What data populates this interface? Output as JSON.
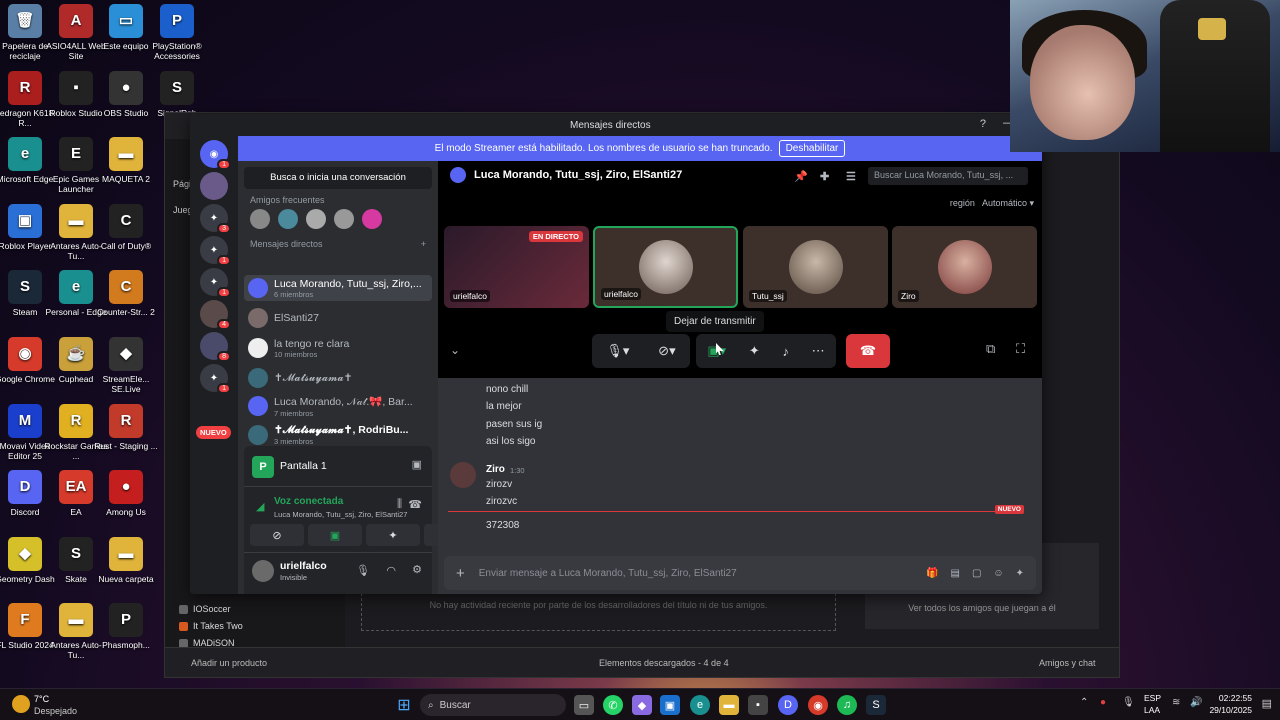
{
  "desktop_icons": [
    {
      "label": "Papelera de reciclaje",
      "glyph": "🗑",
      "color": "#5a7fa6"
    },
    {
      "label": "ASIO4ALL Web Site",
      "glyph": "A",
      "color": "#b02a2a"
    },
    {
      "label": "Este equipo",
      "glyph": "▭",
      "color": "#2a8fd6"
    },
    {
      "label": "PlayStation® Accessories",
      "glyph": "P",
      "color": "#1a5fcc"
    },
    {
      "label": "Redragon K618-R...",
      "glyph": "R",
      "color": "#aa1e1e"
    },
    {
      "label": "Roblox Studio",
      "glyph": "▪",
      "color": "#222"
    },
    {
      "label": "OBS Studio",
      "glyph": "●",
      "color": "#333"
    },
    {
      "label": "SignalRgb",
      "glyph": "S",
      "color": "#222"
    },
    {
      "label": "Microsoft Edge",
      "glyph": "e",
      "color": "#1a8f8f"
    },
    {
      "label": "Epic Games Launcher",
      "glyph": "E",
      "color": "#222"
    },
    {
      "label": "MAQUETA 2",
      "glyph": "▬",
      "color": "#e0b43a"
    },
    {
      "label": "Roblox Player",
      "glyph": "▣",
      "color": "#2a6fd6"
    },
    {
      "label": "Antares Auto-Tu...",
      "glyph": "▬",
      "color": "#e0b43a"
    },
    {
      "label": "Call of Duty®",
      "glyph": "C",
      "color": "#222"
    },
    {
      "label": "Steam",
      "glyph": "S",
      "color": "#1b2838"
    },
    {
      "label": "Personal - Edge",
      "glyph": "e",
      "color": "#1a8f8f"
    },
    {
      "label": "Counter-Str... 2",
      "glyph": "C",
      "color": "#d27a1e"
    },
    {
      "label": "Google Chrome",
      "glyph": "◉",
      "color": "#d63a2a"
    },
    {
      "label": "Cuphead",
      "glyph": "☕",
      "color": "#c9a03a"
    },
    {
      "label": "StreamEle... SE.Live",
      "glyph": "◆",
      "color": "#333"
    },
    {
      "label": "Movavi Video Editor 25",
      "glyph": "M",
      "color": "#1a3fcc"
    },
    {
      "label": "Rockstar Games ...",
      "glyph": "R",
      "color": "#e0b020"
    },
    {
      "label": "Rust - Staging ...",
      "glyph": "R",
      "color": "#c23a2a"
    },
    {
      "label": "Discord",
      "glyph": "D",
      "color": "#5865f2"
    },
    {
      "label": "EA",
      "glyph": "EA",
      "color": "#d63a2a"
    },
    {
      "label": "Among Us",
      "glyph": "●",
      "color": "#c41e1e"
    },
    {
      "label": "Geometry Dash",
      "glyph": "◆",
      "color": "#d6c02a"
    },
    {
      "label": "Skate",
      "glyph": "S",
      "color": "#222"
    },
    {
      "label": "Nueva carpeta",
      "glyph": "▬",
      "color": "#e0b43a"
    },
    {
      "label": "FL Studio 2024",
      "glyph": "F",
      "color": "#e07a1e"
    },
    {
      "label": "Antares Auto-Tu...",
      "glyph": "▬",
      "color": "#e0b43a"
    },
    {
      "label": "Phasmoph...",
      "glyph": "P",
      "color": "#222"
    }
  ],
  "launcher": {
    "sidebar_labels": [
      "Pági",
      "Jueg"
    ],
    "games": [
      "IOSoccer",
      "It Takes Two",
      "MADiSON"
    ],
    "empty_activity": "No hay actividad reciente por parte de los desarrolladores del título ni de tus amigos.",
    "friends_link": "Ver todos los amigos que juegan a él",
    "footer": {
      "add": "Añadir un producto",
      "downloads": "Elementos descargados - 4 de 4",
      "friends": "Amigos y chat"
    }
  },
  "discord": {
    "title": "Mensajes directos",
    "streamer_banner": "El modo Streamer está habilitado. Los nombres de usuario se han truncado.",
    "disable_button": "Deshabilitar",
    "guild_badges": [
      "1",
      "3",
      "1",
      "1",
      "4",
      "8",
      "1"
    ],
    "new_label": "NUEVO",
    "search_conversation": "Busca o inicia una conversación",
    "frequent_friends": "Amigos frecuentes",
    "direct_messages": "Mensajes directos",
    "dms": [
      {
        "name": "Luca Morando, Tutu_ssj, Ziro,...",
        "sub": "6 miembros",
        "selected": true
      },
      {
        "name": "ElSanti27",
        "sub": ""
      },
      {
        "name": "la tengo re clara",
        "sub": "10 miembros"
      },
      {
        "name": "✝𝓜𝓪𝓽𝓼𝓾𝔂𝓪𝓶𝓪✝",
        "sub": ""
      },
      {
        "name": "Luca Morando, 𝒩𝒶𝓉.🎀, Bar...",
        "sub": "7 miembros"
      },
      {
        "name": "✝𝓜𝓪𝓽𝓼𝓾𝔂𝓪𝓶𝓪✝, RodriBu...",
        "sub": "3 miembros"
      }
    ],
    "stream_panel": {
      "title": "Pantalla 1"
    },
    "voice": {
      "status": "Voz conectada",
      "channel": "Luca Morando, Tutu_ssj, Ziro, ElSanti27"
    },
    "user": {
      "name": "urielfalco",
      "status": "Invisible"
    },
    "header": {
      "channel": "Luca Morando, Tutu_ssj, Ziro, ElSanti27",
      "search_placeholder": "Buscar Luca Morando, Tutu_ssj, ..."
    },
    "region": {
      "label": "región",
      "value": "Automático"
    },
    "tiles": [
      {
        "name": "urielfalco",
        "live": "EN DIRECTO"
      },
      {
        "name": "urielfalco"
      },
      {
        "name": "Tutu_ssj"
      },
      {
        "name": "Ziro"
      }
    ],
    "tooltip": "Dejar de transmitir",
    "messages_prev": [
      "nono chill",
      "la mejor",
      "pasen sus ig",
      "asi los sigo"
    ],
    "message_author": "Ziro",
    "message_time": "1:30",
    "messages_ziro": [
      "zirozv",
      "zirozvc"
    ],
    "new_divider": "NUEVO",
    "last_message": "372308",
    "composer_placeholder": "Enviar mensaje a Luca Morando, Tutu_ssj, Ziro, ElSanti27"
  },
  "taskbar": {
    "weather_temp": "7°C",
    "weather_desc": "Despejado",
    "search": "Buscar",
    "lang_top": "ESP",
    "lang_bottom": "LAA",
    "time": "02:22:55",
    "date": "29/10/2025"
  },
  "colors": {
    "blurple": "#5865f2",
    "danger": "#da373c",
    "green": "#23a55a"
  }
}
